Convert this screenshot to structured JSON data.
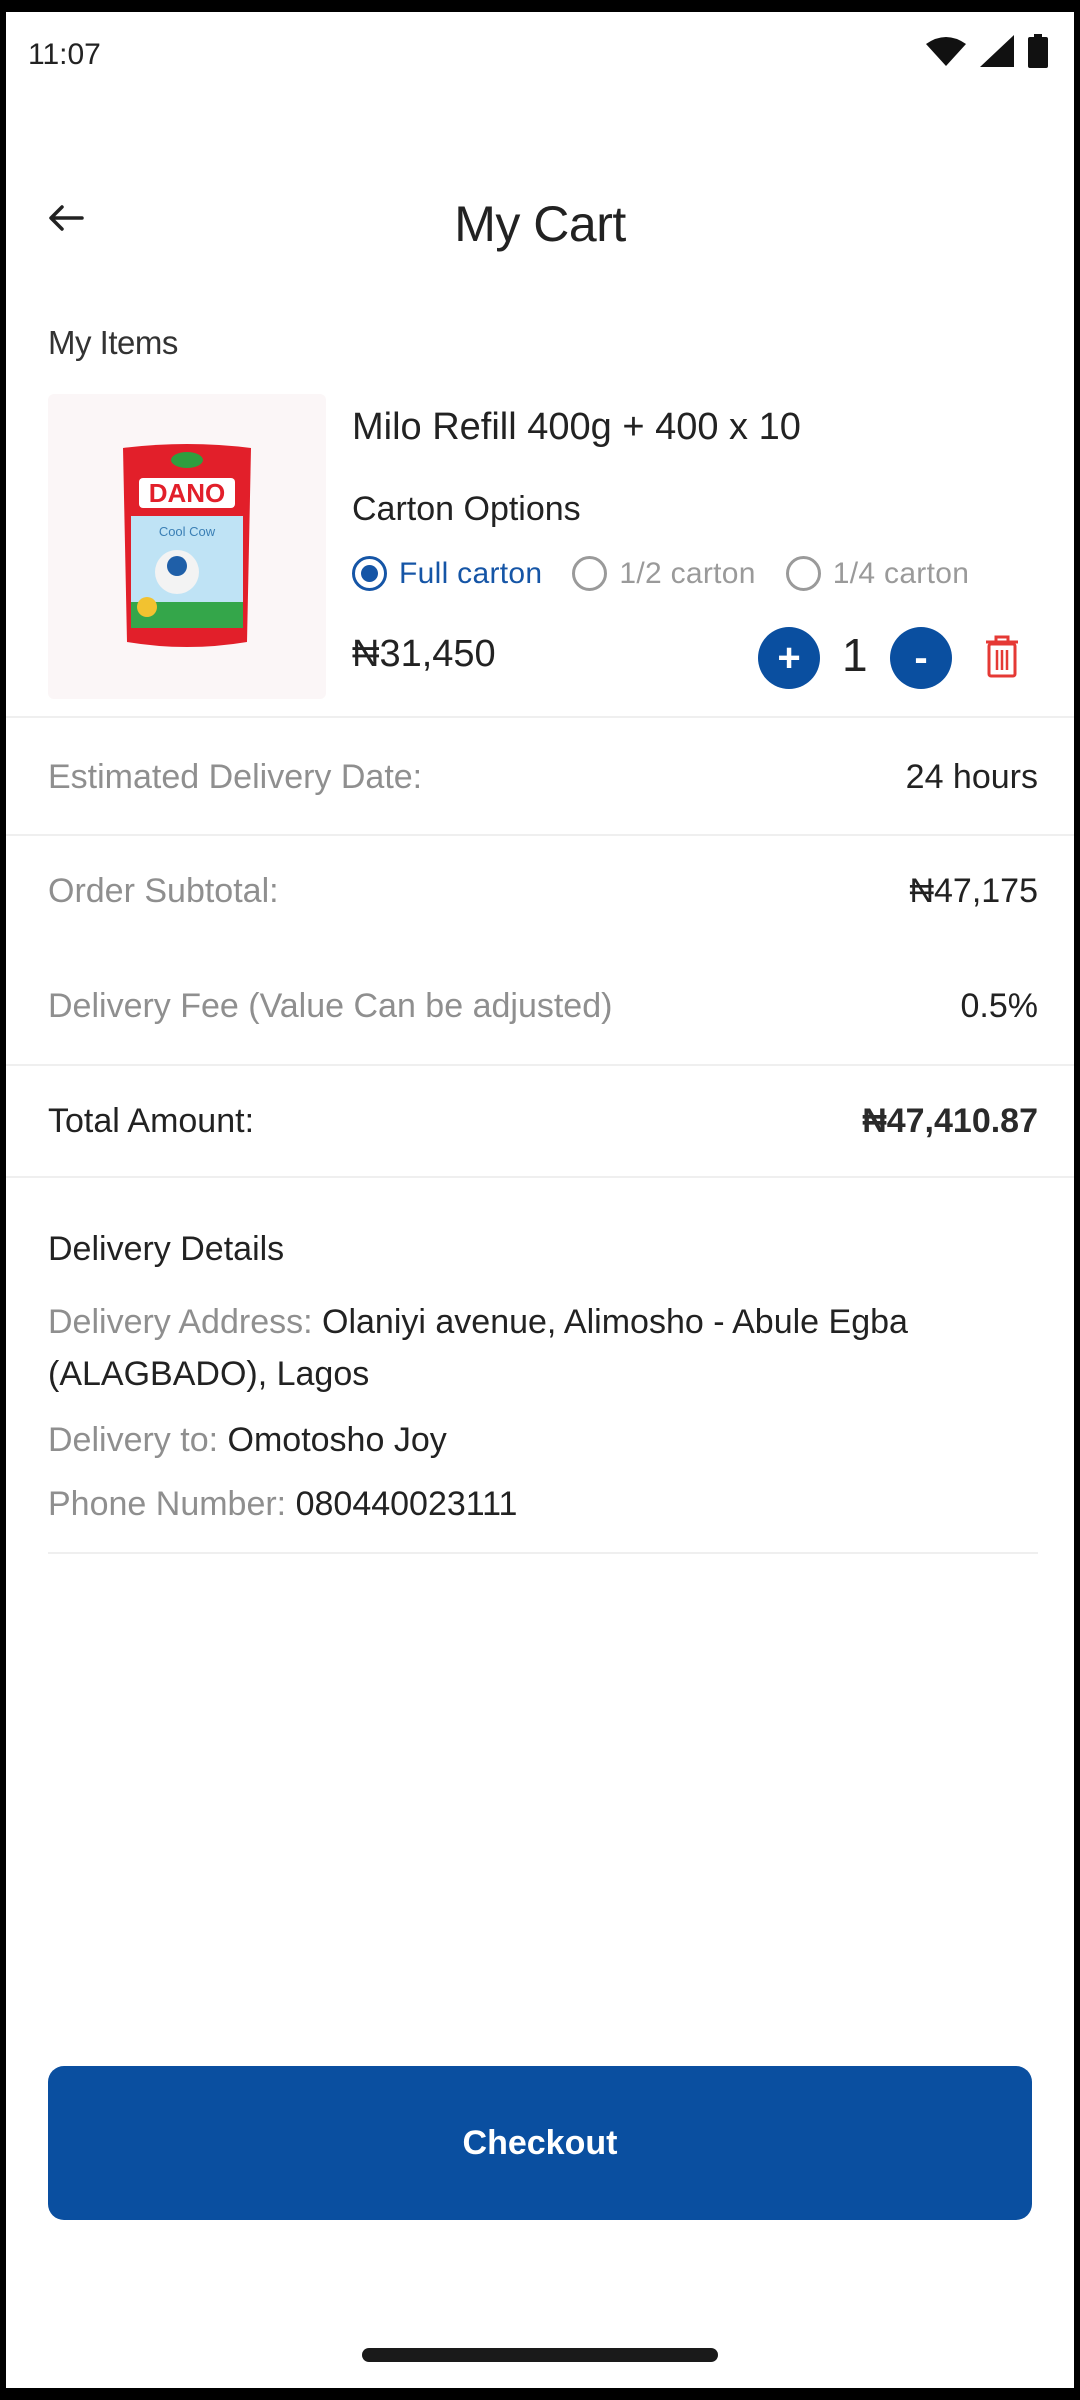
{
  "status_bar": {
    "time": "11:07",
    "icons": [
      "wifi-icon",
      "signal-icon",
      "battery-icon"
    ]
  },
  "header": {
    "title": "My Cart",
    "back_icon": "arrow-left-icon"
  },
  "items_section": {
    "label": "My Items"
  },
  "product": {
    "name": "Milo Refill 400g + 400 x 10",
    "image_brand": "DANO",
    "image_caption": "Cool Cow",
    "carton_label": "Carton Options",
    "carton_options": [
      "Full carton",
      "1/2 carton",
      "1/4 carton"
    ],
    "selected_option": "Full carton",
    "price": "₦31,450",
    "quantity": "1",
    "plus_label": "+",
    "minus_label": "-"
  },
  "summary": {
    "delivery_date_label": "Estimated Delivery Date:",
    "delivery_date_value": "24 hours",
    "subtotal_label": "Order Subtotal:",
    "subtotal_value": "₦47,175",
    "fee_label": "Delivery Fee (Value Can be adjusted)",
    "fee_value": "0.5%",
    "total_label": "Total Amount:",
    "total_value": "₦47,410.87"
  },
  "delivery": {
    "title": "Delivery Details",
    "address_label": "Delivery Address:",
    "address_value": "Olaniyi  avenue, Alimosho - Abule Egba (ALAGBADO), Lagos",
    "to_label": "Delivery to:",
    "to_value": "Omotosho Joy",
    "phone_label": "Phone Number:",
    "phone_value": "080440023111"
  },
  "checkout": {
    "label": "Checkout"
  },
  "colors": {
    "primary": "#0a4fa0",
    "delete": "#e53935",
    "muted": "#8f8f8f"
  }
}
